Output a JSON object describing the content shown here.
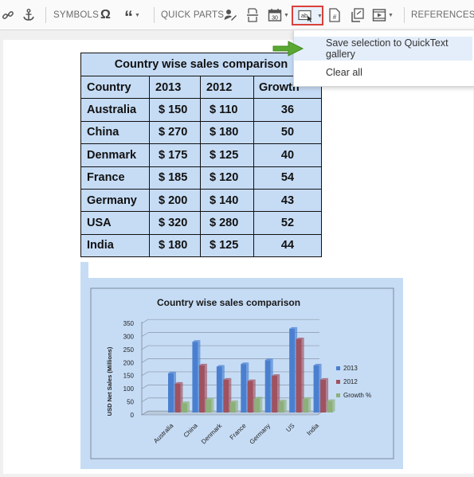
{
  "toolbar": {
    "symbols_label": "SYMBOLS",
    "quick_parts_label": "QUICK PARTS",
    "references_label": "REFERENCES",
    "calendar_number": "30",
    "quicktext_icon_text": "ab"
  },
  "menu": {
    "items": [
      "Save selection to QuickText gallery",
      "Clear all"
    ]
  },
  "table": {
    "title": "Country wise sales comparison",
    "headers": [
      "Country",
      "2013",
      "2012",
      "Growth %"
    ],
    "rows": [
      [
        "Australia",
        "$ 150",
        "$ 110",
        "36"
      ],
      [
        "China",
        "$ 270",
        "$ 180",
        "50"
      ],
      [
        "Denmark",
        "$ 175",
        "$ 125",
        "40"
      ],
      [
        "France",
        "$ 185",
        "$ 120",
        "54"
      ],
      [
        "Germany",
        "$ 200",
        "$ 140",
        "43"
      ],
      [
        "USA",
        "$ 320",
        "$ 280",
        "52"
      ],
      [
        "India",
        "$ 180",
        "$ 125",
        "44"
      ]
    ]
  },
  "chart_data": {
    "type": "bar",
    "title": "Country wise sales comparison",
    "ylabel": "USD Net Sales (Millions)",
    "xlabel": "",
    "categories": [
      "Australia",
      "China",
      "Denmark",
      "France",
      "Germany",
      "US",
      "India"
    ],
    "series": [
      {
        "name": "2013",
        "values": [
          150,
          270,
          175,
          185,
          200,
          320,
          180
        ],
        "color": "#4a7fd0"
      },
      {
        "name": "2012",
        "values": [
          110,
          180,
          125,
          120,
          140,
          280,
          125
        ],
        "color": "#a0525f"
      },
      {
        "name": "Growth %",
        "values": [
          36,
          50,
          40,
          54,
          43,
          52,
          44
        ],
        "color": "#8db07a"
      }
    ],
    "ylim": [
      0,
      350
    ],
    "yticks": [
      0,
      50,
      100,
      150,
      200,
      250,
      300,
      350
    ],
    "grid": true,
    "legend": "right"
  },
  "colors": {
    "table_fill": "#c6dcf5",
    "highlight_border": "#d9413a",
    "menu_hover": "#e4eefa",
    "arrow": "#5aa832"
  }
}
